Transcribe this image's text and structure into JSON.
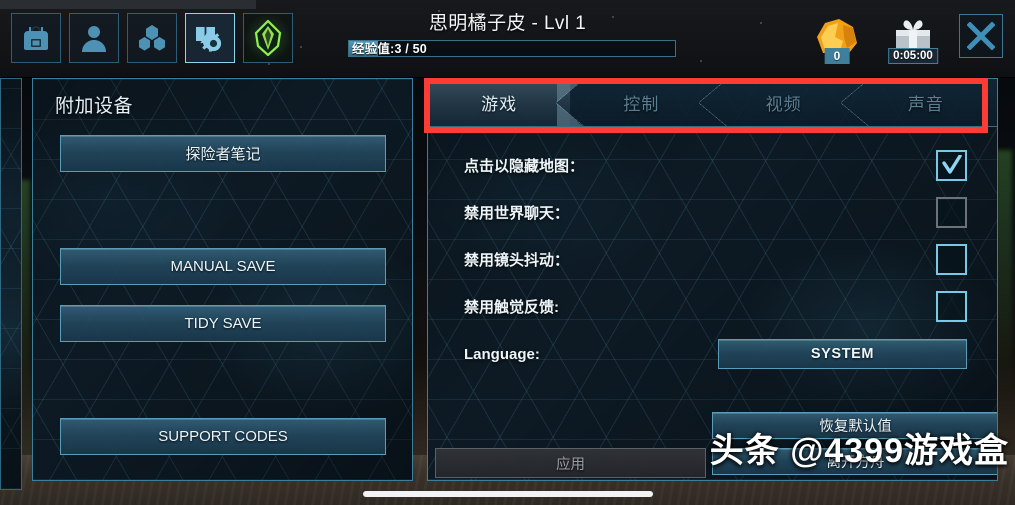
{
  "header": {
    "title": "思明橘子皮 - Lvl 1",
    "xp": {
      "text": "经验值:3 / 50",
      "current": 3,
      "max": 50,
      "fill_percent": 9
    },
    "icons": [
      {
        "name": "backpack-icon",
        "label": "背包"
      },
      {
        "name": "character-icon",
        "label": "角色"
      },
      {
        "name": "crafting-icon",
        "label": "制作"
      },
      {
        "name": "settings-icon",
        "label": "设置"
      },
      {
        "name": "gem-icon",
        "label": "水晶"
      }
    ],
    "resources": [
      {
        "name": "ore-resource",
        "value": "0"
      },
      {
        "name": "gift-timer",
        "value": "0:05:00"
      }
    ],
    "close_label": "✕"
  },
  "left_panel": {
    "title": "附加设备",
    "buttons": [
      {
        "label": "探险者笔记",
        "name": "explorer-notes-button"
      },
      {
        "label": "MANUAL SAVE",
        "name": "manual-save-button"
      },
      {
        "label": "TIDY SAVE",
        "name": "tidy-save-button"
      },
      {
        "label": "SUPPORT CODES",
        "name": "support-codes-button"
      }
    ]
  },
  "right_panel": {
    "tabs": [
      {
        "label": "游戏",
        "active": true
      },
      {
        "label": "控制",
        "active": false
      },
      {
        "label": "视频",
        "active": false
      },
      {
        "label": "声音",
        "active": false
      }
    ],
    "options": [
      {
        "label": "点击以隐藏地图：",
        "checked": true,
        "state": "checked"
      },
      {
        "label": "禁用世界聊天：",
        "checked": false,
        "state": "dim"
      },
      {
        "label": "禁用镜头抖动：",
        "checked": false,
        "state": "normal"
      },
      {
        "label": "禁用触觉反馈:",
        "checked": false,
        "state": "normal"
      }
    ],
    "language": {
      "label": "Language:",
      "value": "SYSTEM"
    },
    "actions": {
      "restore_defaults": "恢复默认值",
      "leave_ark": "离开方舟",
      "apply": "应用",
      "apply_disabled": true
    }
  },
  "overlay": {
    "watermark": "头条 @4399游戏盒"
  },
  "colors": {
    "accent": "#5b9db8",
    "panel_border": "#3d7e9a",
    "highlight_red": "#fc3c35",
    "checkbox_active": "#79c8e8",
    "badge_blue": "#3f7f9c"
  }
}
